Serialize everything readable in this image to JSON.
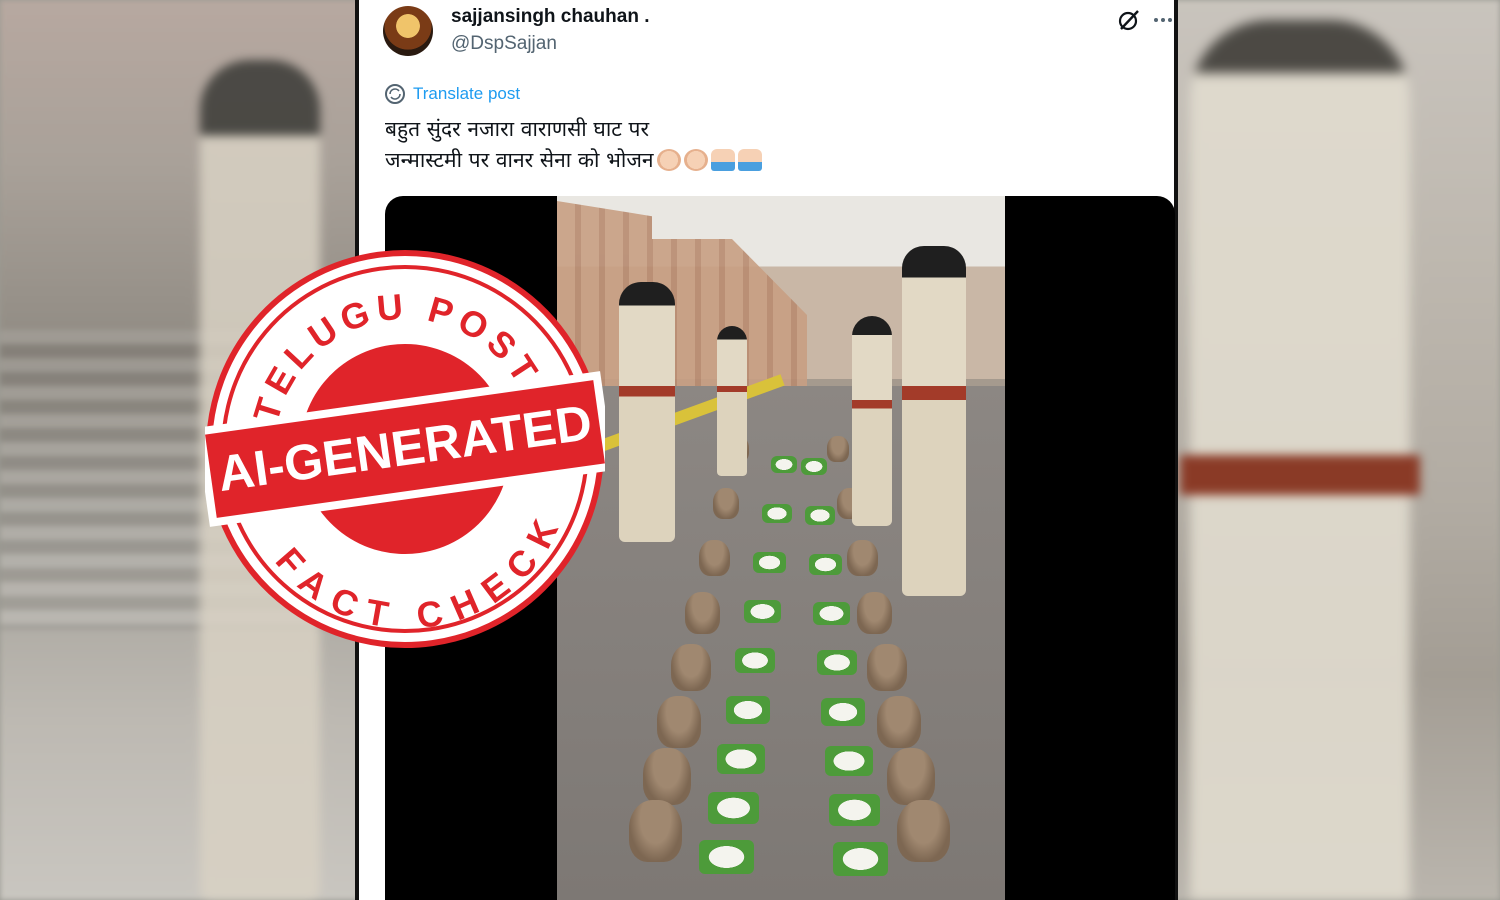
{
  "tweet": {
    "display_name": "sajjansingh chauhan .",
    "handle": "@DspSajjan",
    "translate_label": "Translate post",
    "text_line1": "बहुत सुंदर नजारा वाराणसी घाट पर",
    "text_line2": "जन्मास्टमी पर वानर सेना को भोजन",
    "emojis": [
      "clapping-hands",
      "clapping-hands",
      "folded-hands",
      "folded-hands"
    ],
    "icons": [
      "grok-icon",
      "more-options-icon"
    ]
  },
  "stamp": {
    "top_text": "TELUGU POST",
    "band_text": "AI-GENERATED",
    "bottom_text": "FACT CHECK",
    "color": "#e0242a"
  },
  "colors": {
    "link": "#1d9bf0",
    "text": "#0f1419",
    "muted": "#536471"
  }
}
